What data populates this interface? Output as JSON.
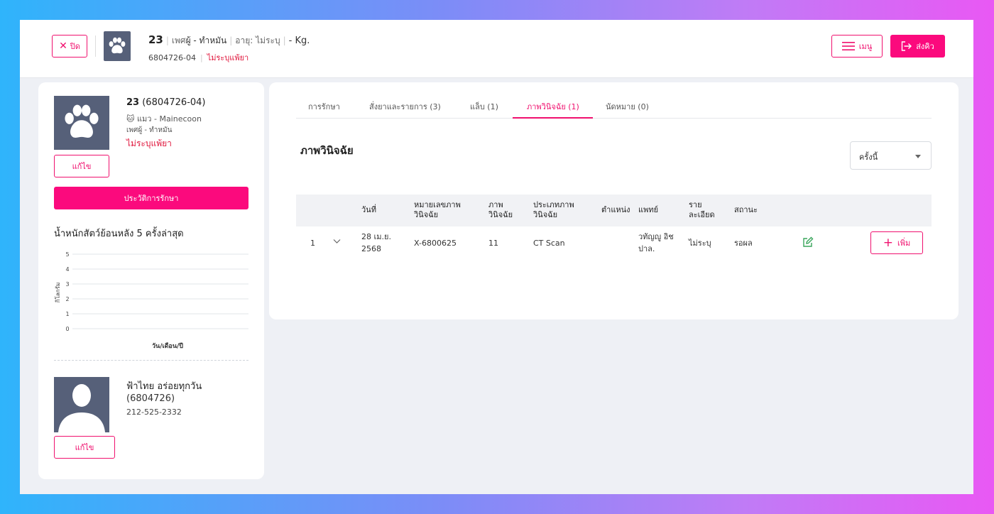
{
  "header": {
    "close_label": "ปิด",
    "pet_number": "23",
    "sex_label": "เพศ",
    "sex_value": "ผู้ - ทำหมัน",
    "age_text": "อายุ: ไม่ระบุ",
    "weight_text": "- Kg.",
    "pet_code": "6804726-04",
    "allergy_text": "ไม่ระบุแพ้ยา",
    "menu_label": "เมนู",
    "send_label": "ส่งคิว"
  },
  "pet": {
    "name": "23",
    "code": "(6804726-04)",
    "species_breed": "แมว - Mainecoon",
    "sex": "เพศผู้ - ทำหมัน",
    "allergy": "ไม่ระบุแพ้ยา",
    "edit_label": "แก้ไข",
    "history_label": "ประวัติการรักษา"
  },
  "weight_chart": {
    "title": "น้ำหนักสัตว์ย้อนหลัง 5 ครั้งล่าสุด",
    "chart_data": {
      "type": "line",
      "ylabel": "กิโลกรัม",
      "xlabel": "วัน/เดือน/ปี",
      "ylim": [
        0,
        5
      ],
      "yticks": [
        "0",
        "1",
        "2",
        "3",
        "4",
        "5"
      ],
      "series": [],
      "grid": true
    }
  },
  "owner": {
    "name": "ฟ้าไทย อร่อยทุกวัน",
    "code": "(6804726)",
    "phone": "212-525-2332",
    "edit_label": "แก้ไข"
  },
  "tabs": [
    {
      "label": "การรักษา",
      "active": false
    },
    {
      "label": "สั่งยาและรายการ (3)",
      "active": false
    },
    {
      "label": "แล็บ (1)",
      "active": false
    },
    {
      "label": "ภาพวินิจฉัย (1)",
      "active": true
    },
    {
      "label": "นัดหมาย (0)",
      "active": false
    }
  ],
  "section": {
    "title": "ภาพวินิจฉัย",
    "filter_value": "ครั้งนี้"
  },
  "table": {
    "headers": {
      "date": "วันที่",
      "image_no_1": "หมายเลขภาพ",
      "image_no_2": "วินิจฉัย",
      "image_1": "ภาพ",
      "image_2": "วินิจฉัย",
      "type_1": "ประเภทภาพ",
      "type_2": "วินิจฉัย",
      "position": "ตำแหน่ง",
      "doctor": "แพทย์",
      "detail_1": "ราย",
      "detail_2": "ละเอียด",
      "status": "สถานะ"
    },
    "rows": [
      {
        "index": "1",
        "date_1": "28 เม.ย.",
        "date_2": "2568",
        "image_no": "X-6800625",
        "image": "11",
        "type": "CT Scan",
        "position": "",
        "doctor_1": "วทัญญู อิช",
        "doctor_2": "ปาล.",
        "detail": "ไม่ระบุ",
        "status": "รอผล",
        "add_label": "เพิ่ม"
      }
    ]
  },
  "colors": {
    "accent": "#fb0a7d",
    "danger_text": "#e0163c",
    "edit_icon": "#3aa55c",
    "avatar_bg": "#566079"
  }
}
